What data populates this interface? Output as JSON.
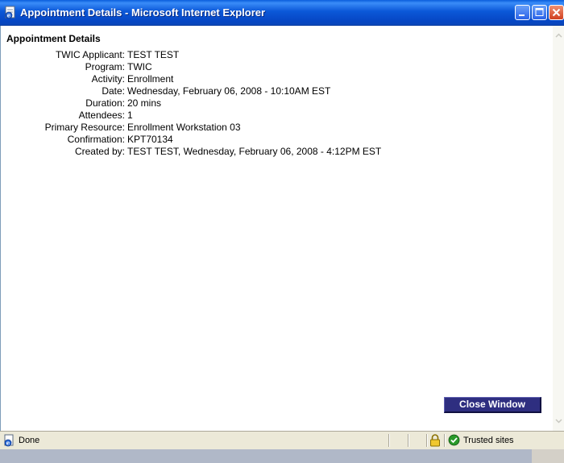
{
  "window": {
    "title": "Appointment Details - Microsoft Internet Explorer"
  },
  "page": {
    "heading": "Appointment Details",
    "details": [
      {
        "label": "TWIC Applicant:",
        "value": "TEST TEST"
      },
      {
        "label": "Program:",
        "value": "TWIC"
      },
      {
        "label": "Activity:",
        "value": "Enrollment"
      },
      {
        "label": "Date:",
        "value": "Wednesday, February 06, 2008 - 10:10AM EST"
      },
      {
        "label": "Duration:",
        "value": "20 mins"
      },
      {
        "label": "Attendees:",
        "value": "1"
      },
      {
        "label": "Primary Resource:",
        "value": "Enrollment Workstation 03"
      },
      {
        "label": "Confirmation:",
        "value": "KPT70134"
      },
      {
        "label": "Created by:",
        "value": "TEST TEST, Wednesday, February 06, 2008 - 4:12PM EST"
      }
    ],
    "close_button_label": "Close Window"
  },
  "statusbar": {
    "status": "Done",
    "zone": "Trusted sites"
  },
  "icons": {
    "window": "ie-page-icon",
    "minimize": "minimize-icon",
    "maximize": "maximize-icon",
    "close": "close-icon",
    "status": "ie-page-icon",
    "lock": "lock-icon",
    "zone": "trusted-zone-check-icon"
  },
  "colors": {
    "titlebar": "#0b58d8",
    "close_button_bg": "#2e2e80",
    "zone_check": "#2a9a2a"
  }
}
